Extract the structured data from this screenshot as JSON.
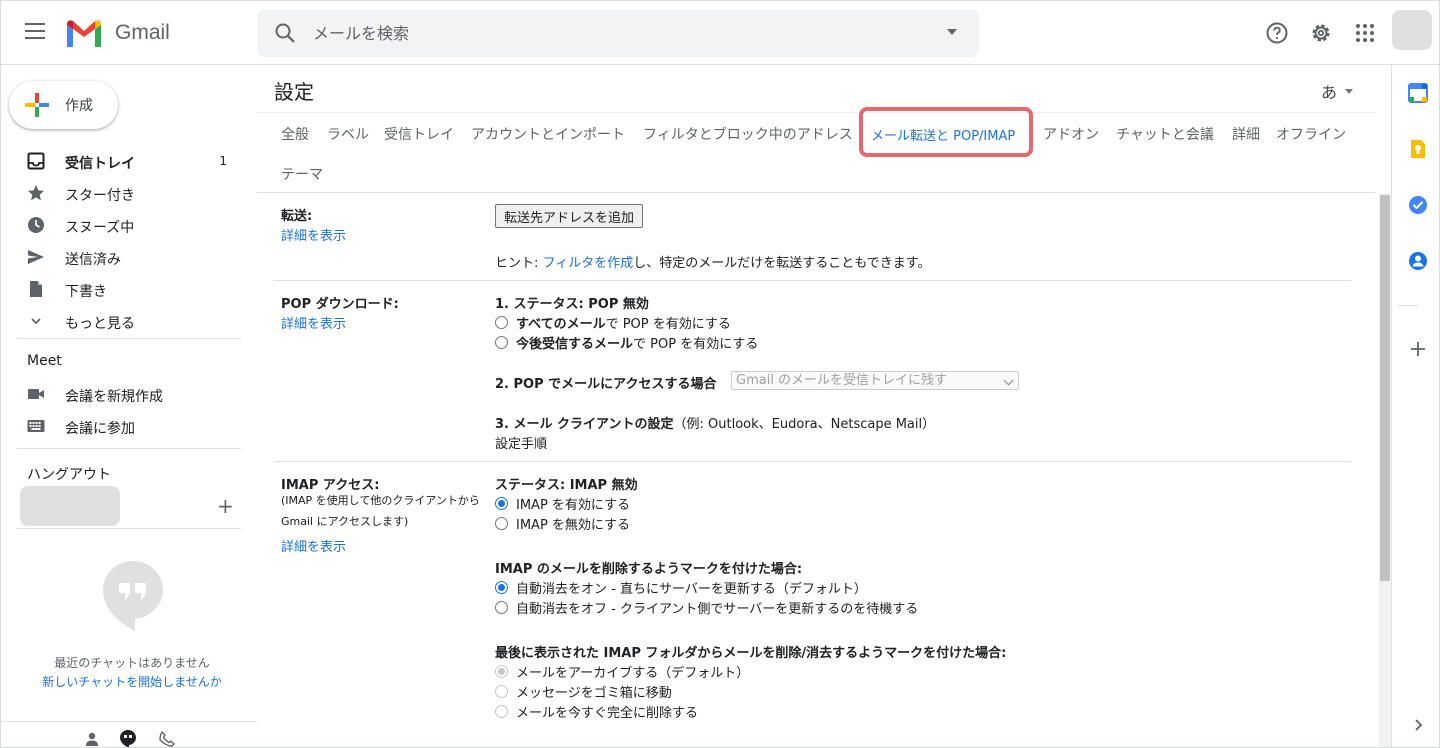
{
  "app": {
    "name": "Gmail"
  },
  "search": {
    "placeholder": "メールを検索"
  },
  "compose": {
    "label": "作成"
  },
  "nav": {
    "items": [
      {
        "label": "受信トレイ",
        "count": "1"
      },
      {
        "label": "スター付き"
      },
      {
        "label": "スヌーズ中"
      },
      {
        "label": "送信済み"
      },
      {
        "label": "下書き"
      },
      {
        "label": "もっと見る"
      }
    ]
  },
  "meet": {
    "title": "Meet",
    "new_meeting": "会議を新規作成",
    "join": "会議に参加"
  },
  "hangouts": {
    "title": "ハングアウト",
    "no_chats": "最近のチャットはありません",
    "start_chat": "新しいチャットを開始しませんか"
  },
  "settings": {
    "title": "設定",
    "lang": "あ",
    "tabs": [
      "全般",
      "ラベル",
      "受信トレイ",
      "アカウントとインポート",
      "フィルタとブロック中のアドレス",
      "メール転送と POP/IMAP",
      "アドオン",
      "チャットと会議",
      "詳細",
      "オフライン",
      "テーマ"
    ],
    "active_tab": "メール転送と POP/IMAP"
  },
  "forwarding": {
    "label": "転送:",
    "details_link": "詳細を表示",
    "button": "転送先アドレスを追加",
    "hint_prefix": "ヒント: ",
    "hint_link": "フィルタを作成",
    "hint_suffix": "し、特定のメールだけを転送することもできます。"
  },
  "pop": {
    "label": "POP ダウンロード:",
    "details_link": "詳細を表示",
    "status": "1. ステータス: POP 無効",
    "opt1_bold": "すべてのメール",
    "opt1_rest": "で POP を有効にする",
    "opt2_bold": "今後受信するメール",
    "opt2_rest": "で POP を有効にする",
    "access_label": "2. POP でメールにアクセスする場合",
    "access_select": "Gmail のメールを受信トレイに残す",
    "client_bold": "3. メール クライアントの設定",
    "client_rest": "（例: Outlook、Eudora、Netscape Mail）",
    "setup_link": "設定手順"
  },
  "imap": {
    "label": "IMAP アクセス:",
    "sub": "(IMAP を使用して他のクライアントから Gmail にアクセスします)",
    "details_link": "詳細を表示",
    "status": "ステータス: IMAP 無効",
    "enable": "IMAP を有効にする",
    "disable": "IMAP を無効にする",
    "delete_title": "IMAP のメールを削除するようマークを付けた場合:",
    "expunge_on": "自動消去をオン - 直ちにサーバーを更新する（デフォルト）",
    "expunge_off": "自動消去をオフ - クライアント側でサーバーを更新するのを待機する",
    "last_title": "最後に表示された IMAP フォルダからメールを削除/消去するようマークを付けた場合:",
    "archive": "メールをアーカイブする（デフォルト）",
    "trash": "メッセージをゴミ箱に移動",
    "delete_forever": "メールを今すぐ完全に削除する"
  },
  "colors": {
    "accent": "#1a73e8",
    "highlight": "#e8676e"
  }
}
